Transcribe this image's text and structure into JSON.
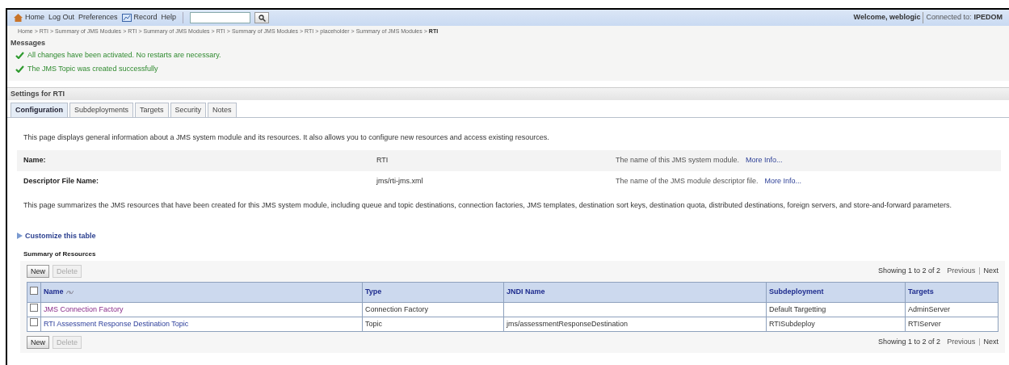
{
  "toolbar": {
    "links": [
      {
        "kind": "home",
        "label": "Home"
      },
      {
        "kind": "plain",
        "label": "Log Out"
      },
      {
        "kind": "plain",
        "label": "Preferences"
      },
      {
        "kind": "record",
        "label": "Record"
      },
      {
        "kind": "plain",
        "label": "Help"
      }
    ],
    "welcome": "Welcome, weblogic",
    "connected_label": "Connected to:",
    "connected_value": "IPEDOM"
  },
  "breadcrumb": [
    {
      "label": "Home",
      "current": false
    },
    {
      "label": "RTI",
      "current": false
    },
    {
      "label": "Summary of JMS Modules",
      "current": false
    },
    {
      "label": "RTI",
      "current": false
    },
    {
      "label": "Summary of JMS Modules",
      "current": false
    },
    {
      "label": "RTI",
      "current": false
    },
    {
      "label": "Summary of JMS Modules",
      "current": false
    },
    {
      "label": "RTI",
      "current": false
    },
    {
      "label": "placeholder",
      "current": false
    },
    {
      "label": "Summary of JMS Modules",
      "current": false
    },
    {
      "label": "RTI",
      "current": true
    }
  ],
  "breadcrumb_separator": ">",
  "messages": {
    "title": "Messages",
    "items": [
      "All changes have been activated. No restarts are necessary.",
      "The JMS Topic was created successfully"
    ]
  },
  "settings_title": "Settings for RTI",
  "tabs": [
    {
      "label": "Configuration",
      "selected": true
    },
    {
      "label": "Subdeployments",
      "selected": false
    },
    {
      "label": "Targets",
      "selected": false
    },
    {
      "label": "Security",
      "selected": false
    },
    {
      "label": "Notes",
      "selected": false
    }
  ],
  "intro": "This page displays general information about a JMS system module and its resources. It also allows you to configure new resources and access existing resources.",
  "fields": [
    {
      "label": "Name:",
      "value": "RTI",
      "help": "The name of this JMS system module.",
      "link": "More Info..."
    },
    {
      "label": "Descriptor File Name:",
      "value": "jms/rti-jms.xml",
      "help": "The name of the JMS module descriptor file.",
      "link": "More Info..."
    }
  ],
  "summary_text": "This page summarizes the JMS resources that have been created for this JMS system module, including queue and topic destinations, connection factories, JMS templates, destination sort keys, destination quota, distributed destinations, foreign servers, and store-and-forward parameters.",
  "customize_link": "Customize this table",
  "table": {
    "title": "Summary of Resources",
    "top_bar": {
      "buttons": [
        {
          "label": "New",
          "disabled": false
        },
        {
          "label": "Delete",
          "disabled": true
        }
      ],
      "paging": {
        "text": "Showing 1 to 2 of 2",
        "previous": "Previous",
        "separator": "|",
        "next": "Next"
      }
    },
    "bottom_bar": {
      "buttons": [
        {
          "label": "New",
          "disabled": false
        },
        {
          "label": "Delete",
          "disabled": true
        }
      ],
      "paging": {
        "text": "Showing 1 to 2 of 2",
        "previous": "Previous",
        "separator": "|",
        "next": "Next"
      }
    },
    "columns": [
      "Name",
      "Type",
      "JNDI Name",
      "Subdeployment",
      "Targets"
    ],
    "header_checked": false,
    "rows": [
      {
        "checked": false,
        "visited": true,
        "name": "JMS Connection Factory",
        "type": "Connection Factory",
        "jndi": "",
        "subdeployment": "Default Targetting",
        "targets": "AdminServer"
      },
      {
        "checked": false,
        "visited": false,
        "name": "RTI Assessment Response Destination Topic",
        "type": "Topic",
        "jndi": "jms/assessmentResponseDestination",
        "subdeployment": "RTISubdeploy",
        "targets": "RTIServer"
      }
    ]
  }
}
